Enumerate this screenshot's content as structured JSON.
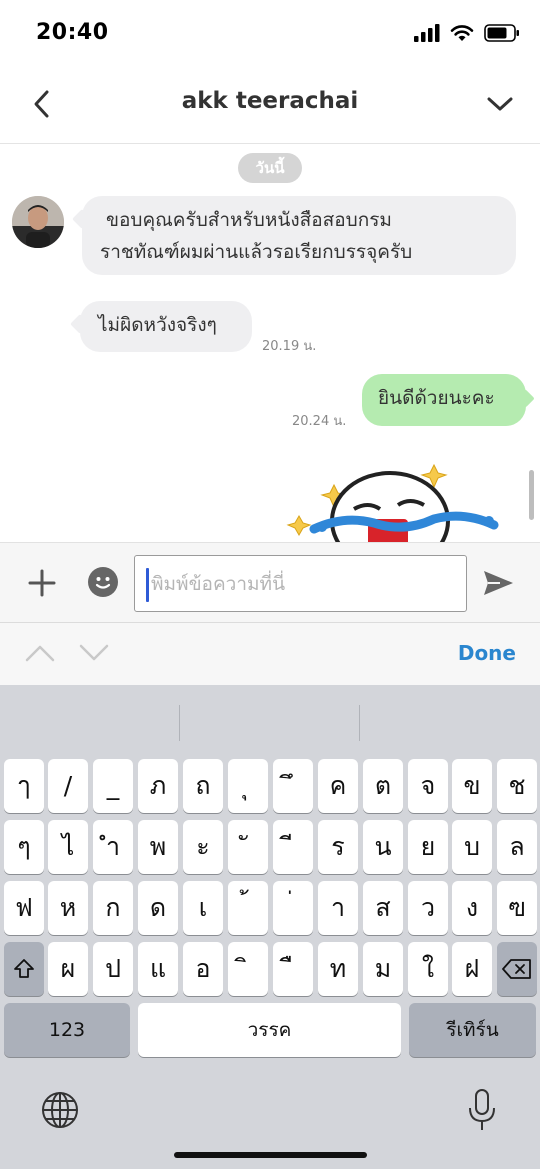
{
  "status_bar": {
    "time": "20:40"
  },
  "header": {
    "title": "akk teerachai"
  },
  "chat": {
    "date_label": "วันนี้",
    "messages": [
      {
        "direction": "in",
        "lines": [
          "ขอบคุณครับสำหรับหนังสือสอบกรม",
          "ราชทัณฑ์ผมผ่านแล้วรอเรียกบรรจุครับ"
        ],
        "time": ""
      },
      {
        "direction": "in",
        "lines": [
          "ไม่ผิดหวังจริงๆ"
        ],
        "time": "20.19 น."
      },
      {
        "direction": "out",
        "lines": [
          "ยินดีด้วยนะคะ"
        ],
        "time": "20.24 น."
      }
    ]
  },
  "input": {
    "placeholder": "พิมพ์ข้อความที่นี่",
    "value": ""
  },
  "accessory": {
    "done_label": "Done"
  },
  "keyboard": {
    "row1": [
      "ๅ",
      "/",
      "_",
      "ภ",
      "ถ",
      "ุ",
      "ึ",
      "ค",
      "ต",
      "จ",
      "ข",
      "ช"
    ],
    "row2": [
      "ๆ",
      "ไ",
      "ำ",
      "พ",
      "ะ",
      "ั",
      "ี",
      "ร",
      "น",
      "ย",
      "บ",
      "ล"
    ],
    "row3": [
      "ฟ",
      "ห",
      "ก",
      "ด",
      "เ",
      "้",
      "่",
      "า",
      "ส",
      "ว",
      "ง",
      "ฃ"
    ],
    "row4": [
      "ผ",
      "ป",
      "แ",
      "อ",
      "ิ",
      "ื",
      "ท",
      "ม",
      "ใ",
      "ฝ"
    ],
    "numbers_label": "123",
    "space_label": "วรรค",
    "return_label": "รีเทิร์น"
  },
  "colors": {
    "outgoing_bubble": "#b5ebb0",
    "incoming_bubble": "#efeff1",
    "accent": "#2a86cf"
  }
}
